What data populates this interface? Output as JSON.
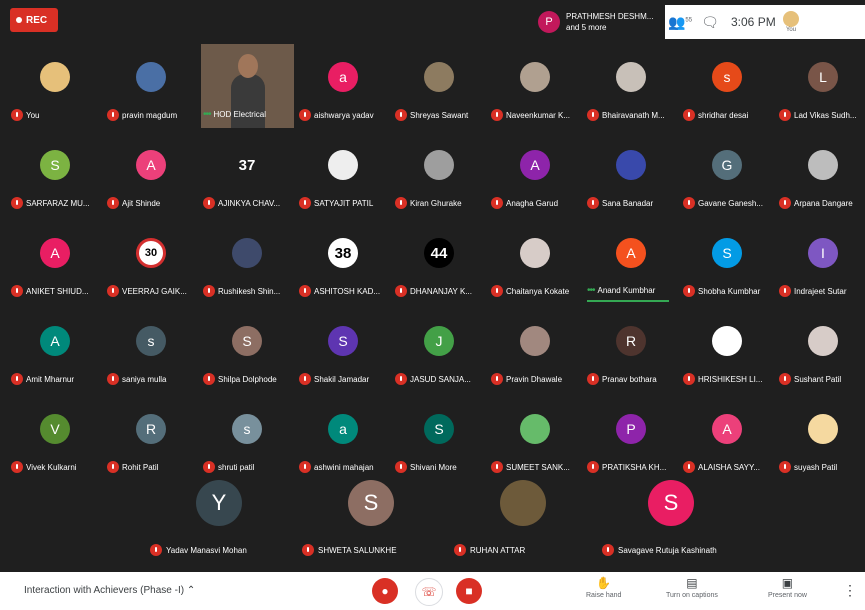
{
  "recording": {
    "label": "REC"
  },
  "presenter": {
    "initial": "P",
    "name": "PRATHMESH DESHM...",
    "more": "and 5 more"
  },
  "topbar": {
    "people_count": "55",
    "time": "3:06 PM",
    "you_label": "You"
  },
  "rows": [
    [
      {
        "name": "You",
        "avatar": "photo",
        "color": "#e6c07a",
        "initial": ""
      },
      {
        "name": "pravin magdum",
        "avatar": "photo",
        "color": "#4a6fa5",
        "initial": ""
      },
      {
        "name": "HOD Electrical",
        "avatar": "video",
        "color": "#6d5a4a",
        "initial": "",
        "speaking": true
      },
      {
        "name": "aishwarya yadav",
        "avatar": "letter",
        "color": "#e91e63",
        "initial": "a"
      },
      {
        "name": "Shreyas Sawant",
        "avatar": "photo",
        "color": "#8d7b60",
        "initial": ""
      },
      {
        "name": "Naveenkumar K...",
        "avatar": "photo",
        "color": "#b0a090",
        "initial": ""
      },
      {
        "name": "Bhairavanath M...",
        "avatar": "photo",
        "color": "#c8c0b8",
        "initial": ""
      },
      {
        "name": "shridhar desai",
        "avatar": "letter",
        "color": "#e64a19",
        "initial": "s"
      },
      {
        "name": "Lad Vikas Sudh...",
        "avatar": "letter",
        "color": "#795548",
        "initial": "L"
      }
    ],
    [
      {
        "name": "SARFARAZ MU...",
        "avatar": "letter",
        "color": "#7cb342",
        "initial": "S"
      },
      {
        "name": "Ajit Shinde",
        "avatar": "letter",
        "color": "#ec407a",
        "initial": "A"
      },
      {
        "name": "AJINKYA CHAV...",
        "avatar": "number",
        "color": "transparent",
        "initial": "37"
      },
      {
        "name": "SATYAJIT PATIL",
        "avatar": "photo",
        "color": "#eeeeee",
        "initial": ""
      },
      {
        "name": "Kiran Ghurake",
        "avatar": "photo",
        "color": "#9e9e9e",
        "initial": ""
      },
      {
        "name": "Anagha Garud",
        "avatar": "letter",
        "color": "#8e24aa",
        "initial": "A"
      },
      {
        "name": "Sana Banadar",
        "avatar": "photo",
        "color": "#3949ab",
        "initial": ""
      },
      {
        "name": "Gavane Ganesh...",
        "avatar": "letter",
        "color": "#546e7a",
        "initial": "G"
      },
      {
        "name": "Arpana Dangare",
        "avatar": "photo",
        "color": "#bdbdbd",
        "initial": ""
      }
    ],
    [
      {
        "name": "ANIKET SHIUD...",
        "avatar": "letter",
        "color": "#e91e63",
        "initial": "A"
      },
      {
        "name": "VEERRAJ GAIK...",
        "avatar": "sign",
        "color": "#ffffff",
        "initial": "30"
      },
      {
        "name": "Rushikesh Shin...",
        "avatar": "photo",
        "color": "#3e4a6b",
        "initial": ""
      },
      {
        "name": "ASHITOSH KAD...",
        "avatar": "number-white",
        "color": "#ffffff",
        "initial": "38"
      },
      {
        "name": "DHANANJAY K...",
        "avatar": "number-black",
        "color": "#000000",
        "initial": "44"
      },
      {
        "name": "Chaitanya Kokate",
        "avatar": "photo",
        "color": "#d7ccc8",
        "initial": ""
      },
      {
        "name": "Anand Kumbhar",
        "avatar": "letter",
        "color": "#f4511e",
        "initial": "A",
        "speaking": true
      },
      {
        "name": "Shobha Kumbhar",
        "avatar": "letter",
        "color": "#039be5",
        "initial": "S"
      },
      {
        "name": "Indrajeet Sutar",
        "avatar": "letter",
        "color": "#7e57c2",
        "initial": "I"
      }
    ],
    [
      {
        "name": "Amit Mharnur",
        "avatar": "letter",
        "color": "#00897b",
        "initial": "A"
      },
      {
        "name": "saniya mulla",
        "avatar": "letter",
        "color": "#455a64",
        "initial": "s"
      },
      {
        "name": "Shilpa Dolphode",
        "avatar": "letter",
        "color": "#8d6e63",
        "initial": "S"
      },
      {
        "name": "Shakil Jamadar",
        "avatar": "letter",
        "color": "#5e35b1",
        "initial": "S"
      },
      {
        "name": "JASUD SANJA...",
        "avatar": "letter",
        "color": "#43a047",
        "initial": "J"
      },
      {
        "name": "Pravin Dhawale",
        "avatar": "photo",
        "color": "#a1887f",
        "initial": ""
      },
      {
        "name": "Pranav bothara",
        "avatar": "letter",
        "color": "#4e342e",
        "initial": "R"
      },
      {
        "name": "HRISHIKESH LI...",
        "avatar": "photo",
        "color": "#ffffff",
        "initial": ""
      },
      {
        "name": "Sushant Patil",
        "avatar": "photo",
        "color": "#d7ccc8",
        "initial": ""
      }
    ],
    [
      {
        "name": "Vivek Kulkarni",
        "avatar": "letter",
        "color": "#558b2f",
        "initial": "V"
      },
      {
        "name": "Rohit Patil",
        "avatar": "letter",
        "color": "#546e7a",
        "initial": "R"
      },
      {
        "name": "shruti patil",
        "avatar": "letter",
        "color": "#78909c",
        "initial": "s"
      },
      {
        "name": "ashwini mahajan",
        "avatar": "letter",
        "color": "#00897b",
        "initial": "a"
      },
      {
        "name": "Shivani More",
        "avatar": "letter",
        "color": "#00695c",
        "initial": "S"
      },
      {
        "name": "SUMEET SANK...",
        "avatar": "letter",
        "color": "#66bb6a",
        "initial": ""
      },
      {
        "name": "PRATIKSHA KH...",
        "avatar": "letter",
        "color": "#8e24aa",
        "initial": "P"
      },
      {
        "name": "ALAISHA SAYY...",
        "avatar": "letter",
        "color": "#ec407a",
        "initial": "A"
      },
      {
        "name": "suyash Patil",
        "avatar": "photo",
        "color": "#f5d9a0",
        "initial": ""
      }
    ]
  ],
  "bottom": [
    {
      "name": "Yadav Manasvi Mohan",
      "avatar": "letter",
      "color": "#37474f",
      "initial": "Y"
    },
    {
      "name": "SHWETA SALUNKHE",
      "avatar": "letter",
      "color": "#8d6e63",
      "initial": "S"
    },
    {
      "name": "RUHAN ATTAR",
      "avatar": "photo",
      "color": "#6d5a3a",
      "initial": ""
    },
    {
      "name": "Savagave Rutuja Kashinath",
      "avatar": "letter",
      "color": "#e91e63",
      "initial": "S"
    }
  ],
  "controls": {
    "meeting_name": "Interaction with Achievers (Phase -I)",
    "raise_hand": "Raise hand",
    "captions": "Turn on captions",
    "present": "Present now"
  }
}
